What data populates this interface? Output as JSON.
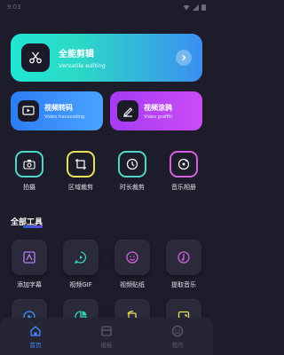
{
  "status_bar": {
    "time": "9:03"
  },
  "hero": {
    "title": "全能剪辑",
    "subtitle": "Versatile editing",
    "icon": "scissors-icon"
  },
  "cards": [
    {
      "title": "视频转码",
      "subtitle": "Video transcoding",
      "icon": "play-screen-icon"
    },
    {
      "title": "视频涂鸦",
      "subtitle": "Video graffiti",
      "icon": "brush-icon"
    }
  ],
  "quick_actions": [
    {
      "label": "拍摄",
      "icon": "camera-icon",
      "color": "#4fd6c5"
    },
    {
      "label": "区域裁剪",
      "icon": "crop-icon",
      "color": "#e8e05a"
    },
    {
      "label": "时长裁剪",
      "icon": "clock-icon",
      "color": "#4fd6c5"
    },
    {
      "label": "音乐相册",
      "icon": "music-disc-icon",
      "color": "#d65fe0"
    }
  ],
  "tools_section": {
    "title": "全部工具",
    "items": [
      {
        "label": "添加字幕",
        "icon": "subtitle-icon",
        "color": "#b57cf5"
      },
      {
        "label": "视频GIF",
        "icon": "gif-chat-icon",
        "color": "#2fd6b6"
      },
      {
        "label": "视频贴纸",
        "icon": "sticker-face-icon",
        "color": "#d65fe0"
      },
      {
        "label": "提取音乐",
        "icon": "music-extract-icon",
        "color": "#d65fe0"
      }
    ],
    "items_row2": [
      {
        "icon": "play-circle-icon",
        "color": "#3f8cff"
      },
      {
        "icon": "pie-icon",
        "color": "#2fd6b6"
      },
      {
        "icon": "rotate-icon",
        "color": "#e8e05a"
      },
      {
        "icon": "frame-icon",
        "color": "#e8e05a"
      }
    ]
  },
  "tabs": [
    {
      "label": "首页",
      "icon": "home-icon",
      "active": true
    },
    {
      "label": "模板",
      "icon": "template-icon",
      "active": false
    },
    {
      "label": "我的",
      "icon": "profile-icon",
      "active": false
    }
  ]
}
